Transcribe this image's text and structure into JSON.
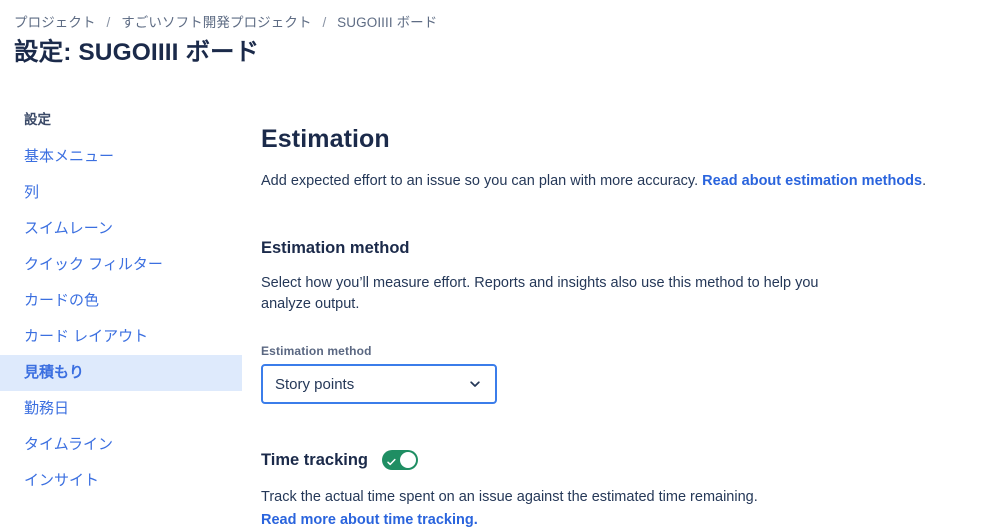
{
  "breadcrumb": {
    "items": [
      "プロジェクト",
      "すごいソフト開発プロジェクト",
      "SUGOIIII ボード"
    ],
    "separator": "/"
  },
  "page": {
    "title": "設定: SUGOIIII ボード"
  },
  "sidebar": {
    "header": "設定",
    "items": [
      {
        "label": "基本メニュー",
        "selected": false
      },
      {
        "label": "列",
        "selected": false
      },
      {
        "label": "スイムレーン",
        "selected": false
      },
      {
        "label": "クイック フィルター",
        "selected": false
      },
      {
        "label": "カードの色",
        "selected": false
      },
      {
        "label": "カード レイアウト",
        "selected": false
      },
      {
        "label": "見積もり",
        "selected": true
      },
      {
        "label": "勤務日",
        "selected": false
      },
      {
        "label": "タイムライン",
        "selected": false
      },
      {
        "label": "インサイト",
        "selected": false
      }
    ]
  },
  "main": {
    "title": "Estimation",
    "lead_text": "Add expected effort to an issue so you can plan with more accuracy. ",
    "lead_link": "Read about estimation methods",
    "lead_tail": ".",
    "estimation_method": {
      "heading": "Estimation method",
      "description": "Select how you’ll measure effort. Reports and insights also use this method to help you analyze output.",
      "field_label": "Estimation method",
      "selected_value": "Story points",
      "chevron_icon": "chevron-down-icon"
    },
    "time_tracking": {
      "heading": "Time tracking",
      "toggle_state": "on",
      "toggle_icon": "check-icon",
      "description": "Track the actual time spent on an issue against the estimated time remaining.",
      "link": "Read more about time tracking."
    }
  },
  "colors": {
    "link": "#2a64dd",
    "sidebar_link": "#3b6fe0",
    "sidebar_selected_bg": "#deeafc",
    "toggle_on": "#1f8e63",
    "focus_border": "#3b7dea",
    "heading": "#1b2a4a",
    "body_text": "#253858",
    "muted_text": "#5e6c84"
  }
}
